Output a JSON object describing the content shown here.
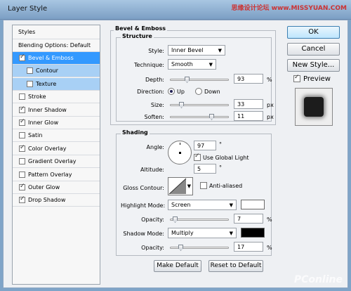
{
  "window": {
    "title": "Layer Style",
    "watermark": "思缘设计论坛 www.MISSYUAN.COM"
  },
  "styles_list": {
    "header": "Styles",
    "blending": "Blending Options: Default",
    "items": [
      {
        "label": "Bevel & Emboss",
        "checked": true,
        "selected": true
      },
      {
        "label": "Contour",
        "checked": false,
        "sub": true
      },
      {
        "label": "Texture",
        "checked": false,
        "sub": true
      },
      {
        "label": "Stroke",
        "checked": false
      },
      {
        "label": "Inner Shadow",
        "checked": true
      },
      {
        "label": "Inner Glow",
        "checked": true
      },
      {
        "label": "Satin",
        "checked": false
      },
      {
        "label": "Color Overlay",
        "checked": true
      },
      {
        "label": "Gradient Overlay",
        "checked": false
      },
      {
        "label": "Pattern Overlay",
        "checked": false
      },
      {
        "label": "Outer Glow",
        "checked": true
      },
      {
        "label": "Drop Shadow",
        "checked": true
      }
    ]
  },
  "bevel": {
    "title": "Bevel & Emboss",
    "structure_title": "Structure",
    "style_label": "Style:",
    "style_value": "Inner Bevel",
    "technique_label": "Technique:",
    "technique_value": "Smooth",
    "depth_label": "Depth:",
    "depth_value": "93",
    "depth_unit": "%",
    "direction_label": "Direction:",
    "direction_up": "Up",
    "direction_down": "Down",
    "size_label": "Size:",
    "size_value": "33",
    "size_unit": "px",
    "soften_label": "Soften:",
    "soften_value": "11",
    "soften_unit": "px"
  },
  "shading": {
    "title": "Shading",
    "angle_label": "Angle:",
    "angle_value": "97",
    "angle_unit": "°",
    "global_light_label": "Use Global Light",
    "altitude_label": "Altitude:",
    "altitude_value": "5",
    "altitude_unit": "°",
    "gloss_label": "Gloss Contour:",
    "anti_aliased_label": "Anti-aliased",
    "highlight_mode_label": "Highlight Mode:",
    "highlight_mode_value": "Screen",
    "highlight_opacity_label": "Opacity:",
    "highlight_opacity_value": "7",
    "highlight_opacity_unit": "%",
    "shadow_mode_label": "Shadow Mode:",
    "shadow_mode_value": "Multiply",
    "shadow_opacity_label": "Opacity:",
    "shadow_opacity_value": "17",
    "shadow_opacity_unit": "%",
    "highlight_color": "#ffffff",
    "shadow_color": "#000000"
  },
  "buttons": {
    "make_default": "Make Default",
    "reset_default": "Reset to Default",
    "ok": "OK",
    "cancel": "Cancel",
    "new_style": "New Style...",
    "preview": "Preview"
  },
  "footer_watermark": "PConline"
}
